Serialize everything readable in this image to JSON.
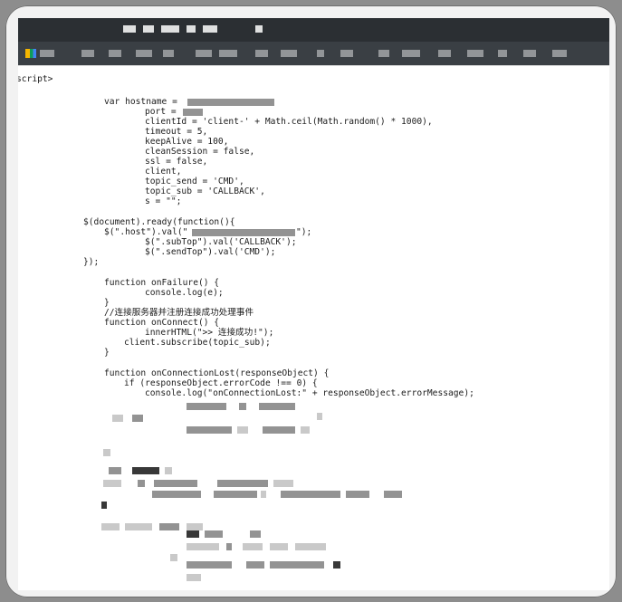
{
  "code_lines": [
    {
      "indent": 0,
      "text": "script>",
      "left": -1
    },
    {
      "text": "var hostname = "
    },
    {
      "text": "port = "
    },
    {
      "text": "clientId = 'client-' + Math.ceil(Math.random() * 1000),"
    },
    {
      "text": "timeout = 5,"
    },
    {
      "text": "keepAlive = 100,"
    },
    {
      "text": "cleanSession = false,"
    },
    {
      "text": "ssl = false,"
    },
    {
      "text": "client,"
    },
    {
      "text": "topic_send = 'CMD',"
    },
    {
      "text": "topic_sub = 'CALLBACK',"
    },
    {
      "text": "s = \"\";"
    },
    {
      "text": "$(document).ready(function(){"
    },
    {
      "text": "$(\".host\").val(\""
    },
    {
      "text": "\");"
    },
    {
      "text": "$(\".subTop\").val('CALLBACK');"
    },
    {
      "text": "$(\".sendTop\").val('CMD');"
    },
    {
      "text": "});"
    },
    {
      "text": "function onFailure() {"
    },
    {
      "text": "console.log(e);"
    },
    {
      "text": "}"
    },
    {
      "text": "//连接服务器并注册连接成功处理事件"
    },
    {
      "text": "function onConnect() {"
    },
    {
      "text": "innerHTML(\">> 连接成功!\");"
    },
    {
      "text": "client.subscribe(topic_sub);"
    },
    {
      "text": "}"
    },
    {
      "text": "function onConnectionLost(responseObject) {"
    },
    {
      "text": "if (responseObject.errorCode !== 0) {"
    },
    {
      "text": "console.log(\"onConnectionLost:\" + responseObject.errorMessage);"
    }
  ]
}
